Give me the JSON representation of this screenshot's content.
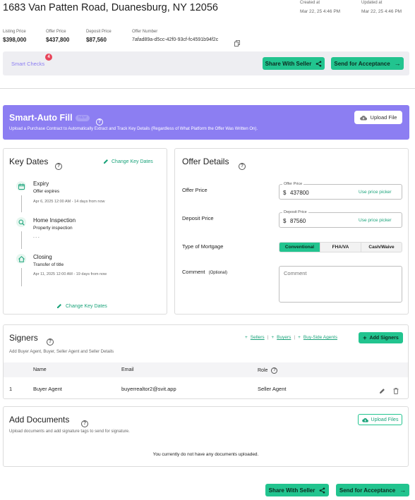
{
  "header": {
    "address": "1683 Van Patten Road, Duanesburg, NY 12056",
    "created_label": "Created at",
    "created_value": "Mar 22, 25 4:46 PM",
    "updated_label": "Updated at",
    "updated_value": "Mar 22, 25 4:46 PM"
  },
  "summary": {
    "listing_label": "Listing Price",
    "listing_value": "$398,000",
    "offer_label": "Offer Price",
    "offer_value": "$437,800",
    "deposit_label": "Deposit Price",
    "deposit_value": "$87,560",
    "number_label": "Offer Number",
    "number_value": "7afad89a-d5cc-42f0-93cf-fc4591b94f2c"
  },
  "toolbar": {
    "smart_checks": "Smart Checks",
    "smart_checks_count": "4",
    "share_label": "Share With Seller",
    "send_label": "Send for Acceptance"
  },
  "smart_fill": {
    "title": "Smart-Auto Fill",
    "badge": "NEW",
    "subtitle": "Upload a Purchase Contract to Automatically Extract and Track Key Details (Regardless of What Platform the Offer Was Written On).",
    "upload_label": "Upload File"
  },
  "key_dates": {
    "title": "Key Dates",
    "change_label": "Change Key Dates",
    "items": [
      {
        "name": "Expiry",
        "desc": "Offer expires",
        "date": "Apr 6, 2025 12:00 AM - 14 days from now"
      },
      {
        "name": "Home Inspection",
        "desc": "Property inspection",
        "date": "- - -"
      },
      {
        "name": "Closing",
        "desc": "Transfer of title",
        "date": "Apr 11, 2025 12:00 AM - 19 days from now"
      }
    ],
    "bottom_change_label": "Change Key Dates"
  },
  "offer_details": {
    "title": "Offer Details",
    "offer_price_label": "Offer Price",
    "offer_price_float": "Offer Price",
    "offer_price_currency": "$",
    "offer_price_value": "437800",
    "offer_price_picker": "Use price picker",
    "deposit_label": "Deposit Price",
    "deposit_float": "Deposit Price",
    "deposit_currency": "$",
    "deposit_value": "87560",
    "deposit_picker": "Use price picker",
    "mortgage_label": "Type of Mortgage",
    "mortgage_options": [
      "Conventional",
      "FHA/VA",
      "Cash/Waive"
    ],
    "mortgage_selected": "Conventional",
    "comment_label": "Comment",
    "comment_optional": "(Optional)",
    "comment_placeholder": "Comment"
  },
  "signers": {
    "title": "Signers",
    "subtitle": "Add Buyer Agent, Buyer, Seller Agent and Seller Details",
    "link_sellers": "Sellers",
    "link_buyers": "Buyers",
    "link_buyside": "Buy-Side Agents",
    "add_label": "Add Signers",
    "columns": [
      "Name",
      "Email",
      "Role"
    ],
    "rows": [
      {
        "index": "1",
        "name": "Buyer Agent",
        "email": "buyerrealtor2@svit.app",
        "role": "Seller Agent"
      }
    ]
  },
  "documents": {
    "title": "Add Documents",
    "subtitle": "Upload documents and add signature tags to send for signature.",
    "upload_label": "Upload Files",
    "empty": "You currently do not have any documents uploaded."
  },
  "footer": {
    "share_label": "Share With Seller",
    "send_label": "Send for Acceptance"
  },
  "colors": {
    "accent_green": "#22c48f",
    "smart_fill_bg": "#8c7ef2",
    "badge_red": "#e8455a"
  }
}
